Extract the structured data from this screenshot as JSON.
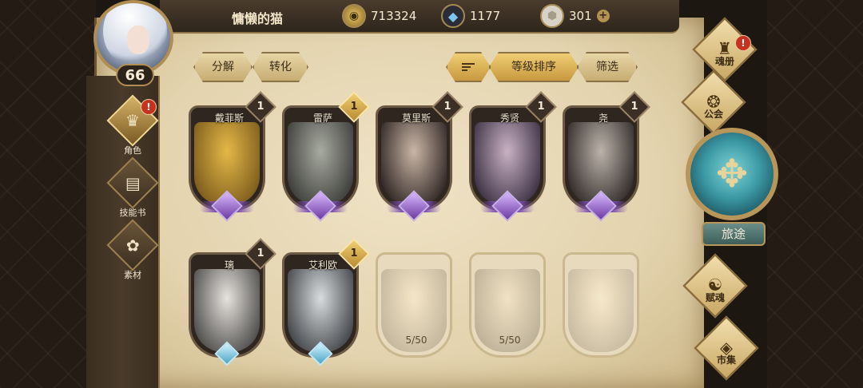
{
  "player": {
    "name": "慵懒的猫",
    "level": "66"
  },
  "resources": {
    "gold": {
      "icon": "gold-coin-icon",
      "value": "713324"
    },
    "crystal": {
      "icon": "blue-crystal-icon",
      "value": "1177"
    },
    "stone": {
      "icon": "soul-stone-icon",
      "value": "301",
      "add": "+"
    }
  },
  "left_menu": [
    {
      "label": "角色",
      "icon": "character-icon",
      "glyph": "♛",
      "badge": "!",
      "active": true
    },
    {
      "label": "技能书",
      "icon": "skill-book-icon",
      "glyph": "▤",
      "active": false
    },
    {
      "label": "素材",
      "icon": "materials-icon",
      "glyph": "✿",
      "active": false
    }
  ],
  "toolbar": {
    "decompose": "分解",
    "convert": "转化",
    "level_sort": "等级排序",
    "filter": "筛选"
  },
  "cards": [
    {
      "name": "戴菲斯",
      "count": "1",
      "count_style": "dark",
      "gem": "purple",
      "art": [
        "#e4b847",
        "#7a5a1c"
      ]
    },
    {
      "name": "雷萨",
      "count": "1",
      "count_style": "gold",
      "gem": "purple",
      "art": [
        "#a8aba0",
        "#3a3b38"
      ]
    },
    {
      "name": "莫里斯",
      "count": "1",
      "count_style": "dark",
      "gem": "purple",
      "art": [
        "#c9b6a6",
        "#2d2322"
      ]
    },
    {
      "name": "秀贤",
      "count": "1",
      "count_style": "dark",
      "gem": "purple",
      "art": [
        "#c8b2c4",
        "#3b2e42"
      ]
    },
    {
      "name": "尧",
      "count": "1",
      "count_style": "dark",
      "gem": "purple",
      "art": [
        "#bcb3aa",
        "#2f2a28"
      ]
    },
    {
      "name": "璃",
      "count": "1",
      "count_style": "dark",
      "gem": "blue",
      "art": [
        "#e6e2de",
        "#4a4947"
      ]
    },
    {
      "name": "艾利欧",
      "count": "1",
      "count_style": "gold",
      "gem": "blue",
      "art": [
        "#d9dcde",
        "#3e4145"
      ]
    },
    {
      "name": "",
      "locked": true,
      "progress": "5/50",
      "art": [
        "#d9c9a8",
        "#8d7d5c"
      ]
    },
    {
      "name": "",
      "locked": true,
      "progress": "5/50",
      "art": [
        "#d4c29f",
        "#857552"
      ]
    },
    {
      "name": "",
      "locked": true,
      "progress": "",
      "art": [
        "#ddcdb0",
        "#95855f"
      ]
    }
  ],
  "right_menu": [
    {
      "label": "魂册",
      "icon": "soul-book-icon",
      "glyph": "♜",
      "badge": "!"
    },
    {
      "label": "公会",
      "icon": "guild-icon",
      "glyph": "❂"
    },
    {
      "label": "赋魂",
      "icon": "soul-infuse-icon",
      "glyph": "☯"
    },
    {
      "label": "市集",
      "icon": "market-icon",
      "glyph": "◈"
    }
  ],
  "travel": {
    "label": "旅途",
    "icon": "travel-emblem-icon",
    "glyph": "✥"
  }
}
